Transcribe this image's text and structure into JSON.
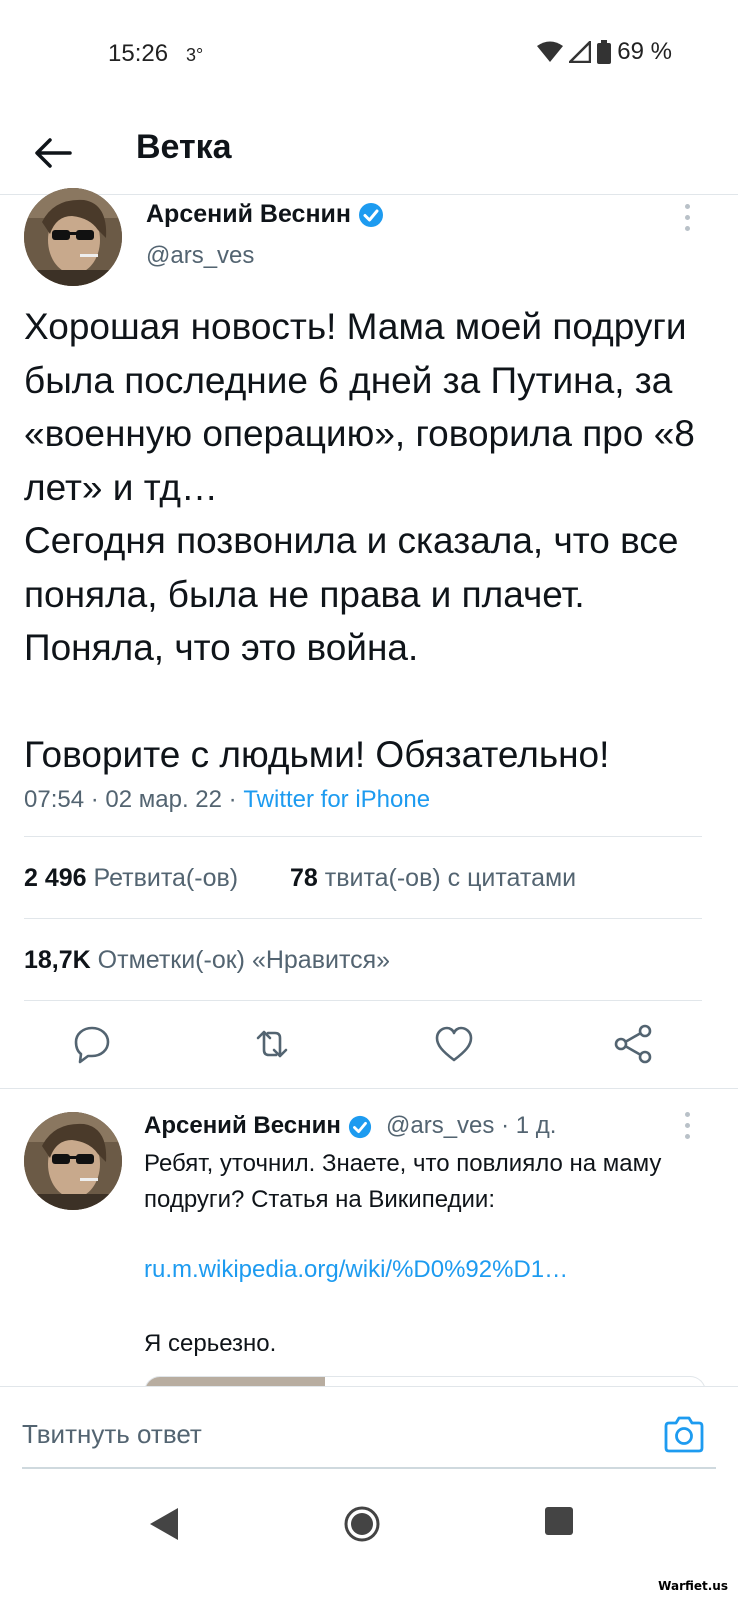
{
  "status_bar": {
    "time": "15:26",
    "temperature": "3°",
    "battery": "69 %",
    "icons": [
      "wifi-icon",
      "signal-icon",
      "battery-icon"
    ]
  },
  "header": {
    "title": "Ветка",
    "back_icon": "arrow-left-icon"
  },
  "main_tweet": {
    "author_name": "Арсений Веснин",
    "handle": "@ars_ves",
    "text": "Хорошая новость! Мама моей подруги была последние 6 дней за Путина, за «военную операцию», говорила про «8 лет» и тд…\nСегодня позвонила и сказала, что все поняла, была не права и плачет. Поняла, что это война.\n\nГоворите с людьми! Обязательно!",
    "time": "07:54",
    "date": "02 мар. 22",
    "source": "Twitter for iPhone",
    "retweets_count": "2 496",
    "retweets_label": "Ретвита(-ов)",
    "quotes_count": "78",
    "quotes_label": "твита(-ов) с цитатами",
    "likes_count": "18,7K",
    "likes_label": "Отметки(-ок) «Нравится»"
  },
  "actions": [
    "reply-icon",
    "retweet-icon",
    "like-icon",
    "share-icon"
  ],
  "reply_tweet": {
    "author_name": "Арсений Веснин",
    "handle_time": "@ars_ves · 1 д.",
    "text": "Ребят, уточнил. Знаете, что повлияло на маму подруги? Статья на Википедии:",
    "link": "ru.m.wikipedia.org/wiki/%D0%92%D1…",
    "text_end": "Я серьезно."
  },
  "compose": {
    "placeholder": "Твитнуть ответ",
    "icon": "camera-icon"
  },
  "nav_bar": [
    "back-triangle-icon",
    "home-circle-icon",
    "recents-square-icon"
  ],
  "watermark": "Warfiet.us",
  "colors": {
    "accent": "#1d9bf0",
    "text": "#0f1419",
    "secondary": "#536471",
    "divider": "#e1e6ea"
  }
}
